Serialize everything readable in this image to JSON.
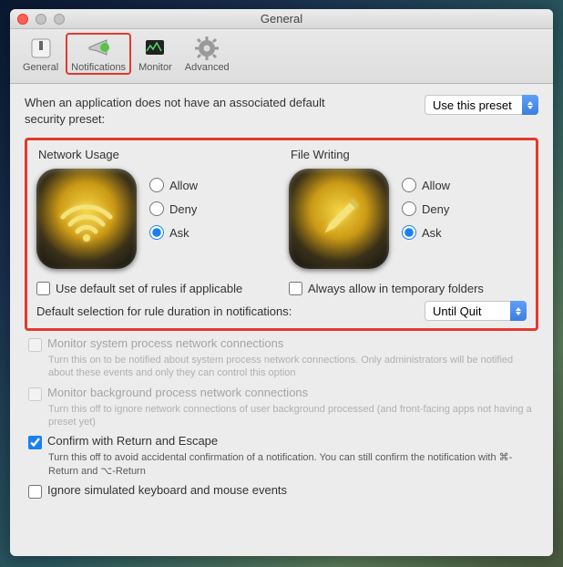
{
  "window": {
    "title": "General"
  },
  "toolbar": {
    "general": "General",
    "notifications": "Notifications",
    "monitor": "Monitor",
    "advanced": "Advanced"
  },
  "preset": {
    "label": "When an application does not have an associated default security preset:",
    "value": "Use this preset"
  },
  "sections": {
    "network": {
      "title": "Network Usage",
      "allow": "Allow",
      "deny": "Deny",
      "ask": "Ask",
      "default_rules": "Use default set of rules if applicable",
      "selected": "ask"
    },
    "file": {
      "title": "File Writing",
      "allow": "Allow",
      "deny": "Deny",
      "ask": "Ask",
      "temp_folders": "Always allow in temporary folders",
      "selected": "ask"
    }
  },
  "duration": {
    "label": "Default selection for rule duration in notifications:",
    "value": "Until Quit"
  },
  "lower": {
    "monitor_system": {
      "label": "Monitor system process network connections",
      "desc": "Turn this on to be notified about system process network connections. Only administrators will be notified about these events and only they can control this option",
      "checked": false,
      "enabled": false
    },
    "monitor_bg": {
      "label": "Monitor background process network connections",
      "desc": "Turn this off to ignore network connections of user background processed (and front-facing apps not having a preset yet)",
      "checked": false,
      "enabled": false
    },
    "confirm": {
      "label": "Confirm with Return and Escape",
      "desc": "Turn this off to avoid accidental confirmation of a notification. You can still confirm the notification with ⌘-Return and ⌥-Return",
      "checked": true,
      "enabled": true
    },
    "ignore_sim": {
      "label": "Ignore simulated keyboard and mouse events",
      "checked": false,
      "enabled": true
    }
  }
}
